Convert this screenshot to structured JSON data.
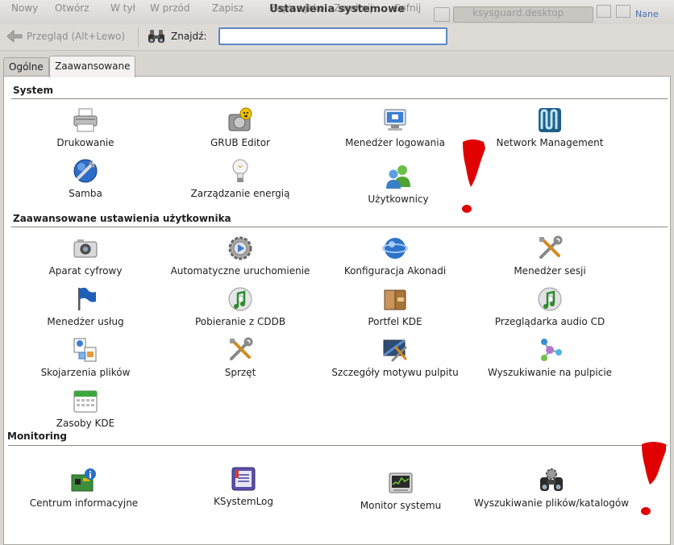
{
  "background_app": {
    "toolbar_items": [
      "Nowy",
      "Otwórz",
      "W tył",
      "W przód",
      "Zapisz",
      "Zapisz jako",
      "Zamknij",
      "Cofnij"
    ],
    "tab_title": "ksysguard.desktop",
    "partial_label": "Nane"
  },
  "window": {
    "title": "Ustawienia systemowe"
  },
  "toolbar": {
    "back_label": "Przegląd (Alt+Lewo)",
    "find_label": "Znajdź:",
    "find_value": ""
  },
  "tabs": [
    {
      "label": "Ogólne",
      "active": false
    },
    {
      "label": "Zaawansowane",
      "active": true
    }
  ],
  "sections": {
    "system": {
      "title": "System",
      "items": [
        {
          "label": "Drukowanie",
          "icon": "printer-icon"
        },
        {
          "label": "GRUB Editor",
          "icon": "grub-editor-icon"
        },
        {
          "label": "Menedżer logowania",
          "icon": "login-manager-icon"
        },
        {
          "label": "Network Management",
          "icon": "network-management-icon"
        },
        {
          "label": "Samba",
          "icon": "samba-icon"
        },
        {
          "label": "Zarządzanie energią",
          "icon": "lightbulb-icon"
        },
        {
          "label": "Użytkownicy",
          "icon": "users-icon"
        }
      ]
    },
    "advanced_user": {
      "title": "Zaawansowane ustawienia użytkownika",
      "items": [
        {
          "label": "Aparat cyfrowy",
          "icon": "camera-icon"
        },
        {
          "label": "Automatyczne uruchomienie",
          "icon": "autostart-gear-icon"
        },
        {
          "label": "Konfiguracja Akonadi",
          "icon": "akonadi-icon"
        },
        {
          "label": "Menedżer sesji",
          "icon": "session-tools-icon"
        },
        {
          "label": "Menedżer usług",
          "icon": "service-flag-icon"
        },
        {
          "label": "Pobieranie z CDDB",
          "icon": "cddb-music-icon"
        },
        {
          "label": "Portfel KDE",
          "icon": "wallet-icon"
        },
        {
          "label": "Przeglądarka audio CD",
          "icon": "audio-cd-icon"
        },
        {
          "label": "Skojarzenia plików",
          "icon": "file-associations-icon"
        },
        {
          "label": "Sprzęt",
          "icon": "hardware-tools-icon"
        },
        {
          "label": "Szczegóły motywu pulpitu",
          "icon": "desktop-theme-icon"
        },
        {
          "label": "Wyszukiwanie na pulpicie",
          "icon": "desktop-search-icon"
        },
        {
          "label": "Zasoby KDE",
          "icon": "calendar-icon"
        }
      ]
    },
    "monitoring": {
      "title": "Monitoring",
      "items": [
        {
          "label": "Centrum informacyjne",
          "icon": "info-center-icon"
        },
        {
          "label": "KSystemLog",
          "icon": "system-log-icon"
        },
        {
          "label": "Monitor systemu",
          "icon": "system-monitor-icon"
        },
        {
          "label": "Wyszukiwanie plików/katalogów",
          "icon": "binoculars-gear-icon"
        }
      ]
    }
  },
  "colors": {
    "accent": "#5b88c2",
    "annotation": "#e00000",
    "pane_background": "#ffffff",
    "window_background": "#dedbd7"
  }
}
